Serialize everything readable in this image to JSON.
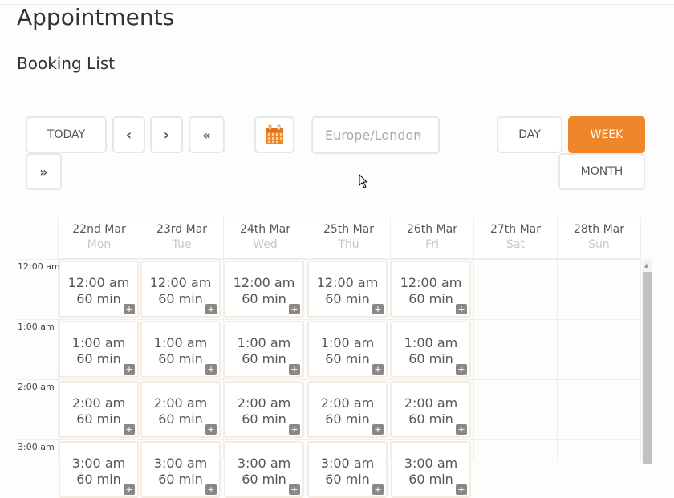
{
  "page": {
    "title": "Appointments",
    "subtitle": "Booking List"
  },
  "toolbar": {
    "today": "TODAY",
    "prev": "‹",
    "next": "›",
    "prev_far": "«",
    "next_far": "»",
    "timezone": "Europe/London",
    "day": "DAY",
    "week": "WEEK",
    "month": "MONTH",
    "active_view": "week",
    "accent": "#f0862a"
  },
  "days": [
    {
      "date": "22nd Mar",
      "weekday": "Mon"
    },
    {
      "date": "23rd Mar",
      "weekday": "Tue"
    },
    {
      "date": "24th Mar",
      "weekday": "Wed"
    },
    {
      "date": "25th Mar",
      "weekday": "Thu"
    },
    {
      "date": "26th Mar",
      "weekday": "Fri"
    },
    {
      "date": "27th Mar",
      "weekday": "Sat"
    },
    {
      "date": "28th Mar",
      "weekday": "Sun"
    }
  ],
  "hours": [
    "12:00 am",
    "1:00 am",
    "2:00 am",
    "3:00 am"
  ],
  "slot_rows": [
    {
      "time": "12:00 am",
      "duration": "60 min"
    },
    {
      "time": "1:00 am",
      "duration": "60 min"
    },
    {
      "time": "2:00 am",
      "duration": "60 min"
    },
    {
      "time": "3:00 am",
      "duration": "60 min"
    }
  ],
  "slot_days": 5,
  "add_label": "+"
}
